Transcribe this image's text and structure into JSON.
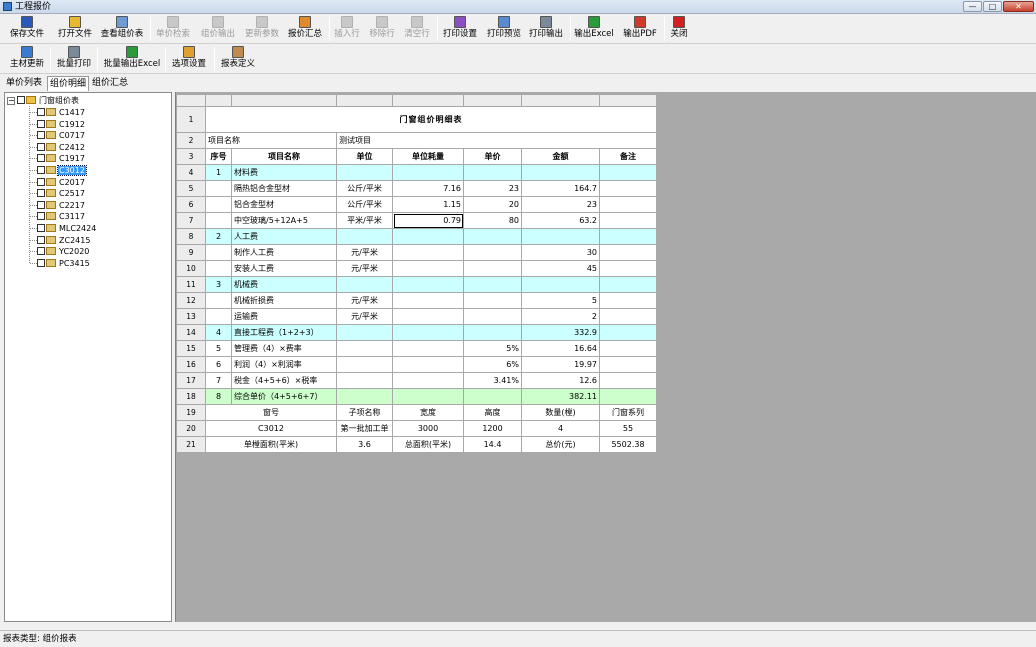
{
  "window": {
    "title": "工程报价",
    "min": "—",
    "max": "□",
    "close": "✕"
  },
  "toolbar1": [
    {
      "label": "保存文件",
      "icon": "save-icon",
      "enabled": true,
      "color": "#2a5ab8"
    },
    {
      "label": "打开文件",
      "icon": "open-folder-icon",
      "enabled": true,
      "color": "#e8b830"
    },
    {
      "label": "查看组价表",
      "icon": "view-table-icon",
      "enabled": true,
      "color": "#6f9bd4"
    },
    {
      "label": "单价检索",
      "icon": "price-search-icon",
      "enabled": false
    },
    {
      "label": "组价输出",
      "icon": "group-output-icon",
      "enabled": false
    },
    {
      "label": "更新参数",
      "icon": "update-params-icon",
      "enabled": false
    },
    {
      "label": "报价汇总",
      "icon": "quote-summary-icon",
      "enabled": true,
      "color": "#e08a30"
    },
    {
      "label": "插入行",
      "icon": "insert-row-icon",
      "enabled": false
    },
    {
      "label": "移除行",
      "icon": "remove-row-icon",
      "enabled": false
    },
    {
      "label": "清空行",
      "icon": "clear-row-icon",
      "enabled": false
    },
    {
      "label": "打印设置",
      "icon": "print-settings-icon",
      "enabled": true,
      "color": "#8a4fc0"
    },
    {
      "label": "打印预览",
      "icon": "print-preview-icon",
      "enabled": true,
      "color": "#5a8ad0"
    },
    {
      "label": "打印输出",
      "icon": "print-icon",
      "enabled": true,
      "color": "#7a8a9a"
    },
    {
      "label": "输出Excel",
      "icon": "excel-icon",
      "enabled": true,
      "color": "#2a9a3a"
    },
    {
      "label": "输出PDF",
      "icon": "pdf-icon",
      "enabled": true,
      "color": "#d03a2a"
    },
    {
      "label": "关闭",
      "icon": "close-icon",
      "enabled": true,
      "color": "#d02020"
    }
  ],
  "toolbar2": [
    {
      "label": "主材更新",
      "icon": "material-update-icon",
      "color": "#3a7ad0"
    },
    {
      "label": "批量打印",
      "icon": "batch-print-icon",
      "color": "#7a8a9a"
    },
    {
      "label": "批量输出Excel",
      "icon": "batch-excel-icon",
      "color": "#2a9a3a"
    },
    {
      "label": "选项设置",
      "icon": "options-icon",
      "color": "#e0a030"
    },
    {
      "label": "报表定义",
      "icon": "report-define-icon",
      "color": "#c08a50"
    }
  ],
  "tabs": [
    {
      "label": "单价列表"
    },
    {
      "label": "组价明细",
      "active": true
    },
    {
      "label": "组价汇总"
    }
  ],
  "tree": {
    "root": "门窗组价表",
    "items": [
      "C1417",
      "C1912",
      "C0717",
      "C2412",
      "C1917",
      "C3012",
      "C2017",
      "C2517",
      "C2217",
      "C3117",
      "MLC2424",
      "ZC2415",
      "YC2020",
      "PC3415"
    ],
    "selected": "C3012"
  },
  "sheet": {
    "title": "门窗组价明细表",
    "project_label": "项目名称",
    "project_value": "测试项目",
    "headers": [
      "序号",
      "项目名称",
      "单位",
      "单位耗量",
      "单价",
      "金额",
      "备注"
    ],
    "rows": [
      {
        "n": "4",
        "cells": [
          "1",
          "材料费",
          "",
          "",
          "",
          "",
          ""
        ],
        "style": "cy"
      },
      {
        "n": "5",
        "cells": [
          "",
          "隔热铝合金型材",
          "公斤/平米",
          "7.16",
          "23",
          "164.7",
          ""
        ]
      },
      {
        "n": "6",
        "cells": [
          "",
          "铝合金型材",
          "公斤/平米",
          "1.15",
          "20",
          "23",
          ""
        ]
      },
      {
        "n": "7",
        "cells": [
          "",
          "中空玻璃/5+12A+5",
          "平米/平米",
          "0.79",
          "80",
          "63.2",
          ""
        ],
        "cur": true
      },
      {
        "n": "8",
        "cells": [
          "2",
          "人工费",
          "",
          "",
          "",
          "",
          ""
        ],
        "style": "cy"
      },
      {
        "n": "9",
        "cells": [
          "",
          "制作人工费",
          "元/平米",
          "",
          "",
          "30",
          ""
        ]
      },
      {
        "n": "10",
        "cells": [
          "",
          "安装人工费",
          "元/平米",
          "",
          "",
          "45",
          ""
        ]
      },
      {
        "n": "11",
        "cells": [
          "3",
          "机械费",
          "",
          "",
          "",
          "",
          ""
        ],
        "style": "cy"
      },
      {
        "n": "12",
        "cells": [
          "",
          "机械折损费",
          "元/平米",
          "",
          "",
          "5",
          ""
        ]
      },
      {
        "n": "13",
        "cells": [
          "",
          "运输费",
          "元/平米",
          "",
          "",
          "2",
          ""
        ]
      },
      {
        "n": "14",
        "cells": [
          "4",
          "直接工程费（1+2+3）",
          "",
          "",
          "",
          "332.9",
          ""
        ],
        "style": "cy"
      },
      {
        "n": "15",
        "cells": [
          "5",
          "管理费（4）×费率",
          "",
          "",
          "5%",
          "16.64",
          ""
        ]
      },
      {
        "n": "16",
        "cells": [
          "6",
          "利润（4）×利润率",
          "",
          "",
          "6%",
          "19.97",
          ""
        ]
      },
      {
        "n": "17",
        "cells": [
          "7",
          "税金（4+5+6）×税率",
          "",
          "",
          "3.41%",
          "12.6",
          ""
        ]
      },
      {
        "n": "18",
        "cells": [
          "8",
          "综合单价（4+5+6+7）",
          "",
          "",
          "",
          "382.11",
          ""
        ],
        "style": "gr"
      }
    ],
    "summary_head": {
      "n": "19",
      "cells": [
        "窗号",
        "子项名称",
        "宽度",
        "高度",
        "数量(樘)",
        "门窗系列"
      ]
    },
    "summary_row": {
      "n": "20",
      "cells": [
        "C3012",
        "第一批加工单",
        "3000",
        "1200",
        "4",
        "55"
      ]
    },
    "total_row": {
      "n": "21",
      "cells": [
        "单樘面积(平米)",
        "3.6",
        "总面积(平米)",
        "14.4",
        "总价(元)",
        "5502.38"
      ]
    },
    "row_labels": [
      "1",
      "2",
      "3"
    ]
  },
  "status": "报表类型:  组价报表"
}
